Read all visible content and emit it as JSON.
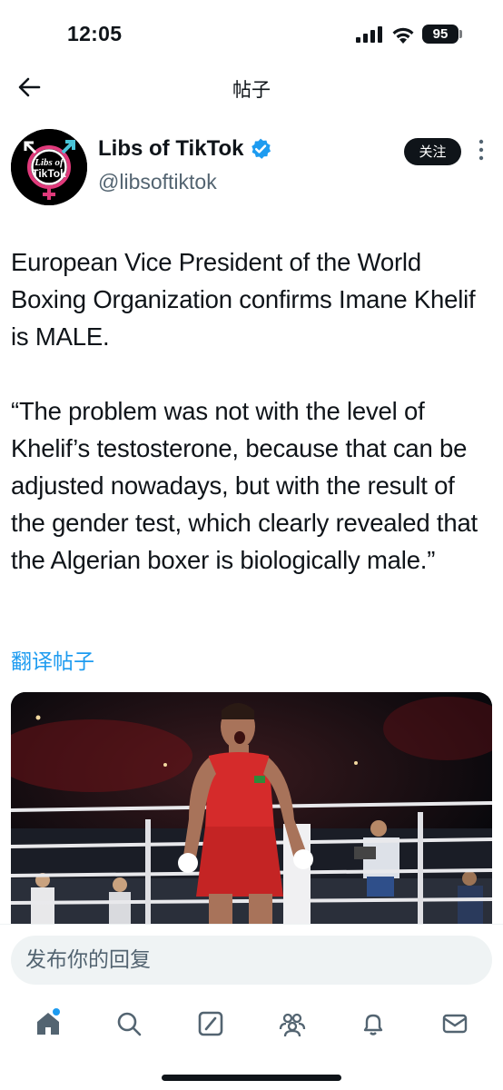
{
  "status_bar": {
    "time": "12:05",
    "battery": "95",
    "icons": [
      "signal-icon",
      "wifi-icon",
      "battery-icon"
    ]
  },
  "header": {
    "back_icon": "arrow-left-icon",
    "title": "帖子"
  },
  "author": {
    "avatar_text_line1": "Libs of",
    "avatar_text_line2": "TikTok",
    "name": "Libs of TikTok",
    "verified_icon": "verified-badge-icon",
    "verified_color": "#1d9bf0",
    "handle": "@libsoftiktok",
    "follow_label": "关注",
    "more_icon": "more-vertical-icon"
  },
  "post": {
    "paragraphs": [
      "European Vice President of the World Boxing Organization confirms Imane Khelif is MALE.",
      "“The problem was not with the level of Khelif’s testosterone, because that can be adjusted nowadays, but with the result of the gender test, which clearly revealed that the Algerian boxer is biologically male.”"
    ],
    "translate_label": "翻译帖子",
    "link_color": "#1d9bf0"
  },
  "reply": {
    "placeholder": "发布你的回复"
  },
  "tab_bar": {
    "items": [
      "home-icon",
      "search-icon",
      "grok-icon",
      "communities-icon",
      "notifications-icon",
      "messages-icon"
    ],
    "active": "home-icon"
  }
}
